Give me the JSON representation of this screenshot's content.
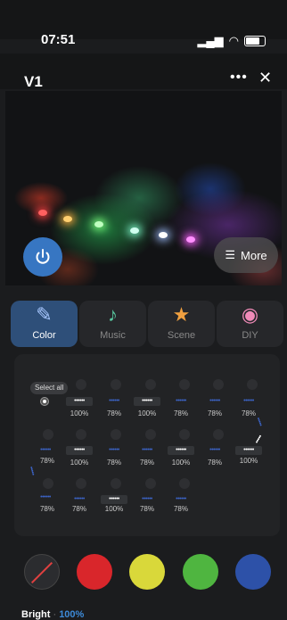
{
  "status": {
    "time": "07:51"
  },
  "header": {
    "title": "V1",
    "more": "•••",
    "close": "✕"
  },
  "hero": {
    "more_label": "More"
  },
  "modes": [
    {
      "label": "Color",
      "icon": "pen-icon",
      "active": true
    },
    {
      "label": "Music",
      "icon": "music-note-icon",
      "active": false
    },
    {
      "label": "Scene",
      "icon": "star-icon",
      "active": false
    },
    {
      "label": "DIY",
      "icon": "palette-icon",
      "active": false
    }
  ],
  "segments": {
    "select_all": "Select all",
    "row1": [
      "100%",
      "78%",
      "100%",
      "78%",
      "78%",
      "78%"
    ],
    "row2": [
      "78%",
      "100%",
      "78%",
      "78%",
      "100%",
      "78%",
      "100%"
    ],
    "row3": [
      "78%",
      "78%",
      "100%",
      "78%",
      "78%"
    ]
  },
  "swatches": {
    "colors": [
      "#d9262b",
      "#d9d83a",
      "#4fb540",
      "#2d51a8"
    ]
  },
  "brightness": {
    "label": "Bright",
    "value": "100%"
  }
}
